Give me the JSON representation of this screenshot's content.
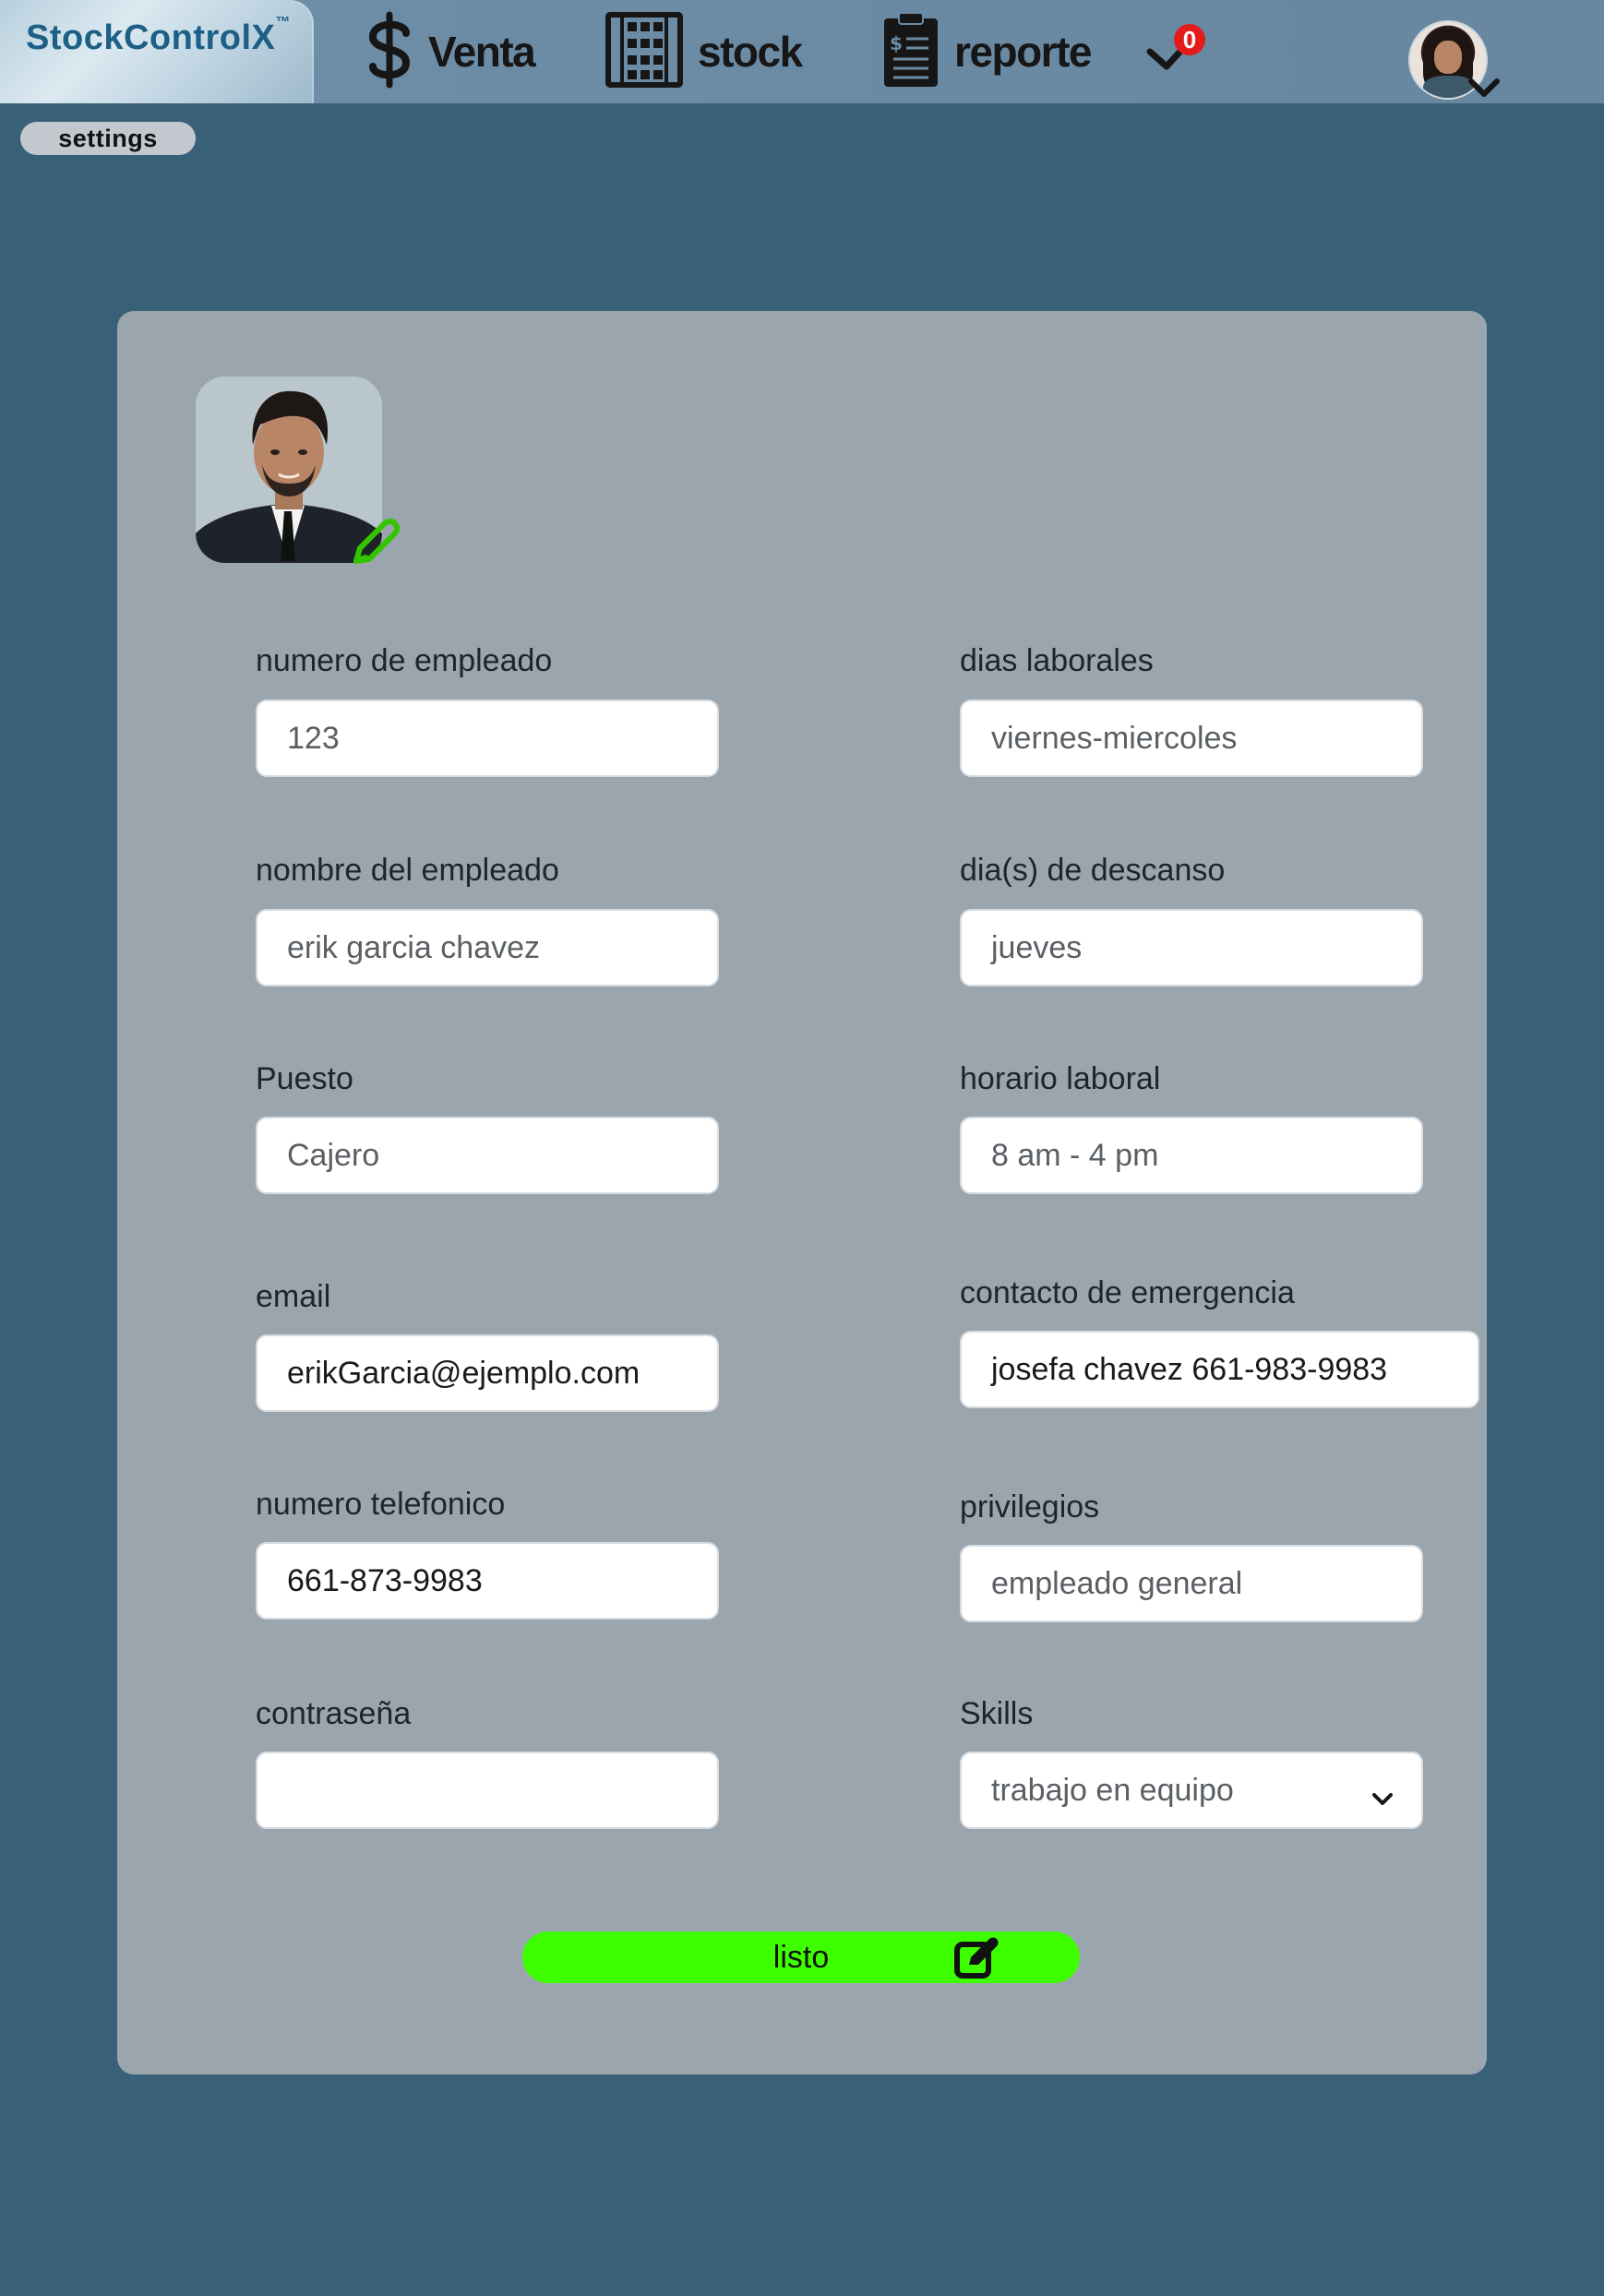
{
  "app": {
    "brand_name": "StockControlX",
    "brand_mark": "™"
  },
  "nav": {
    "items": [
      {
        "label": "Venta",
        "icon": "dollar-icon"
      },
      {
        "label": "stock",
        "icon": "grid-icon"
      },
      {
        "label": "reporte",
        "icon": "report-clipboard-icon"
      }
    ],
    "notification_count": "0"
  },
  "settings_label": "settings",
  "form": {
    "fields": {
      "employee_number": {
        "label": "numero de empleado",
        "value": "123"
      },
      "employee_name": {
        "label": "nombre del empleado",
        "value": "erik garcia chavez"
      },
      "position": {
        "label": "Puesto",
        "value": "Cajero"
      },
      "email": {
        "label": "email",
        "value": "erikGarcia@ejemplo.com"
      },
      "phone": {
        "label": "numero telefonico",
        "value": "661-873-9983"
      },
      "password": {
        "label": "contraseña",
        "value": ""
      },
      "work_days": {
        "label": "dias laborales",
        "value": "viernes-miercoles"
      },
      "rest_days": {
        "label": "dia(s) de descanso",
        "value": "jueves"
      },
      "schedule": {
        "label": "horario laboral",
        "value": "8 am - 4 pm"
      },
      "emergency_contact": {
        "label": "contacto de emergencia",
        "value": "josefa chavez 661-983-9983"
      },
      "privileges": {
        "label": "privilegios",
        "value": "empleado general"
      },
      "skills": {
        "label": "Skills",
        "value": "trabajo en equipo"
      }
    },
    "submit_label": "listo"
  },
  "colors": {
    "background": "#386076",
    "topbar": "#6b8aa3",
    "card": "#9aa5ae",
    "accent_green": "#3dff00",
    "badge_red": "#e31b1b"
  }
}
